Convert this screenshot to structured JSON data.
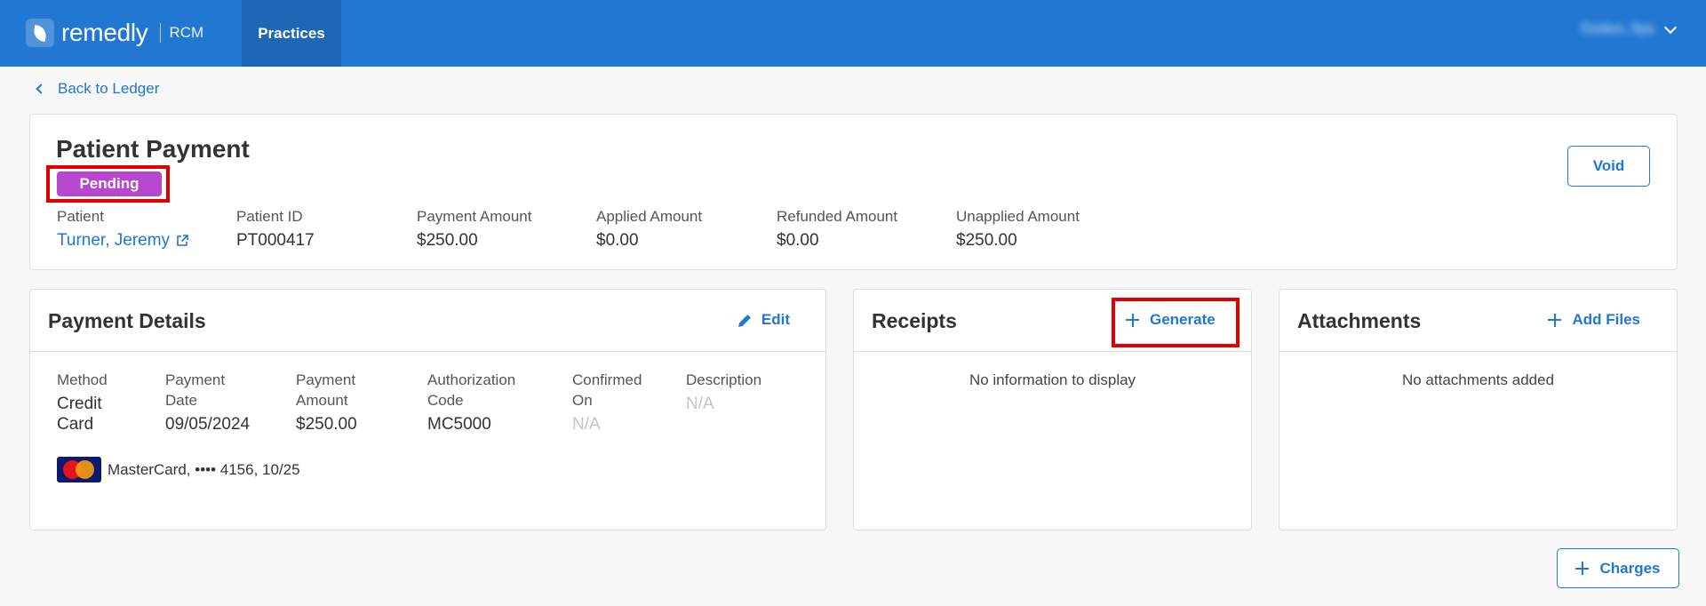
{
  "header": {
    "logo_text": "remedly",
    "logo_sub": "RCM",
    "nav_practices": "Practices",
    "user_name": "Godun, Ilya"
  },
  "back_link": "Back to Ledger",
  "summary": {
    "title": "Patient Payment",
    "status": "Pending",
    "void_label": "Void",
    "fields": [
      {
        "label": "Patient",
        "value": "Turner, Jeremy"
      },
      {
        "label": "Patient ID",
        "value": "PT000417"
      },
      {
        "label": "Payment Amount",
        "value": "$250.00"
      },
      {
        "label": "Applied Amount",
        "value": "$0.00"
      },
      {
        "label": "Refunded Amount",
        "value": "$0.00"
      },
      {
        "label": "Unapplied Amount",
        "value": "$250.00"
      }
    ]
  },
  "payment_details": {
    "title": "Payment Details",
    "edit_label": "Edit",
    "columns": [
      {
        "label_1": "Method",
        "label_2": "",
        "value_1": "Credit",
        "value_2": "Card"
      },
      {
        "label_1": "Payment",
        "label_2": "Date",
        "value_1": "09/05/2024",
        "value_2": ""
      },
      {
        "label_1": "Payment",
        "label_2": "Amount",
        "value_1": "$250.00",
        "value_2": ""
      },
      {
        "label_1": "Authorization",
        "label_2": "Code",
        "value_1": "MC5000",
        "value_2": ""
      },
      {
        "label_1": "Confirmed",
        "label_2": "On",
        "value_1": "N/A",
        "value_2": ""
      },
      {
        "label_1": "Description",
        "label_2": "",
        "value_1": "N/A",
        "value_2": ""
      }
    ],
    "card_logo_text": "MasterCard",
    "card_info": "MasterCard, •••• 4156, 10/25"
  },
  "receipts": {
    "title": "Receipts",
    "generate_label": "Generate",
    "empty": "No information to display"
  },
  "attachments": {
    "title": "Attachments",
    "add_label": "Add Files",
    "empty": "No attachments added"
  },
  "charges_label": "Charges",
  "colors": {
    "topbar": "#2277d3",
    "accent": "#2277d3",
    "status_pending": "#b847d0",
    "highlight": "#e00000"
  }
}
